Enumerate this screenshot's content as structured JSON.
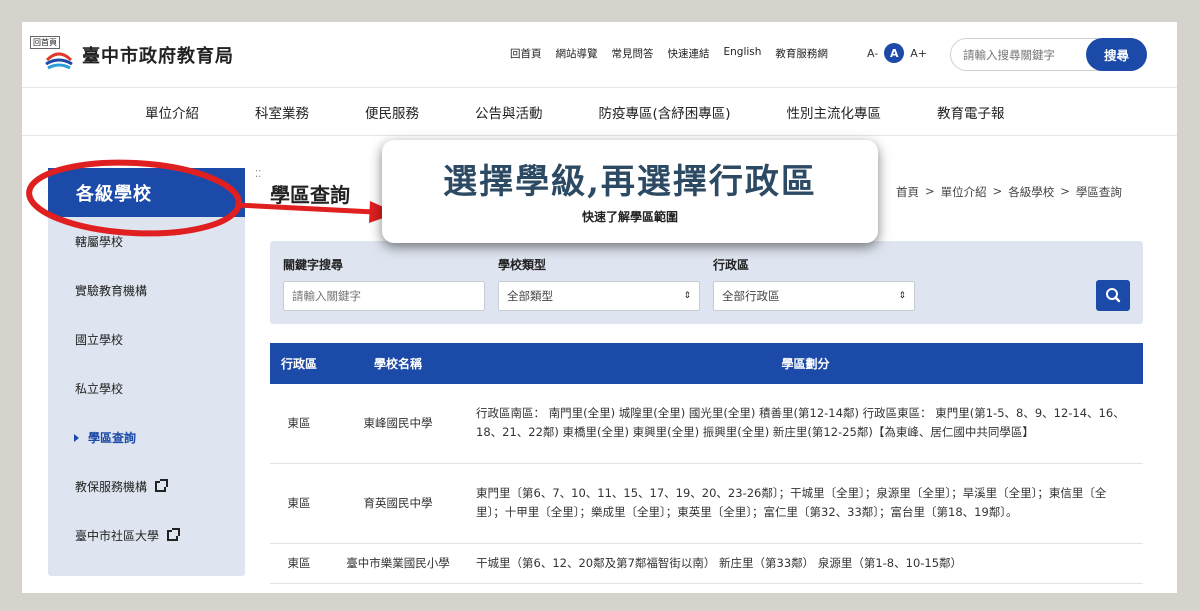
{
  "header": {
    "logo_tag": "回首頁",
    "site_title": "臺中市政府教育局",
    "top_links": [
      "回首頁",
      "網站導覽",
      "常見問答",
      "快速連結",
      "English",
      "教育服務網"
    ],
    "font_sizes": [
      "A-",
      "A",
      "A+"
    ],
    "search_placeholder": "請輸入搜尋關鍵字",
    "search_button": "搜尋"
  },
  "main_nav": [
    "單位介紹",
    "科室業務",
    "便民服務",
    "公告與活動",
    "防疫專區(含紓困專區)",
    "性別主流化專區",
    "教育電子報"
  ],
  "sidebar": {
    "title": "各級學校",
    "items": [
      {
        "label": "轄屬學校"
      },
      {
        "label": "實驗教育機構"
      },
      {
        "label": "國立學校"
      },
      {
        "label": "私立學校"
      },
      {
        "label": "學區查詢",
        "current": true
      },
      {
        "label": "教保服務機構",
        "external": true
      },
      {
        "label": "臺中市社區大學",
        "external": true
      }
    ]
  },
  "page": {
    "title": "學區查詢",
    "breadcrumb": [
      "首頁",
      "單位介紹",
      "各級學校",
      "學區查詢"
    ]
  },
  "filter": {
    "keyword_label": "關鍵字搜尋",
    "keyword_placeholder": "請輸入關鍵字",
    "type_label": "學校類型",
    "type_value": "全部類型",
    "district_label": "行政區",
    "district_value": "全部行政區"
  },
  "table": {
    "headers": [
      "行政區",
      "學校名稱",
      "學區劃分"
    ],
    "rows": [
      {
        "district": "東區",
        "school": "東峰國民中學",
        "zones": "行政區南區： 南門里(全里) 城隍里(全里) 國光里(全里) 積善里(第12-14鄰) 行政區東區： 東門里(第1-5、8、9、12-14、16、18、21、22鄰) 東橋里(全里) 東興里(全里) 振興里(全里) 新庄里(第12-25鄰)【為東峰、居仁國中共同學區】"
      },
      {
        "district": "東區",
        "school": "育英國民中學",
        "zones": "東門里〔第6、7、10、11、15、17、19、20、23-26鄰〕；干城里〔全里〕；泉源里〔全里〕；旱溪里〔全里〕；東信里〔全里〕；十甲里〔全里〕；樂成里〔全里〕；東英里〔全里〕；富仁里〔第32、33鄰〕；富台里〔第18、19鄰〕。"
      },
      {
        "district": "東區",
        "school": "臺中市樂業國民小學",
        "zones": "干城里（第6、12、20鄰及第7鄰福智街以南） 新庄里（第33鄰） 泉源里（第1-8、10-15鄰）"
      }
    ]
  },
  "callout": {
    "headline": "選擇學級,再選擇行政區",
    "subtext": "快速了解學區範圍"
  },
  "colors": {
    "primary": "#1c4aa8",
    "sidebar_bg": "#dfe5f0",
    "annotation_red": "#e02020",
    "headline": "#2c4a63"
  }
}
